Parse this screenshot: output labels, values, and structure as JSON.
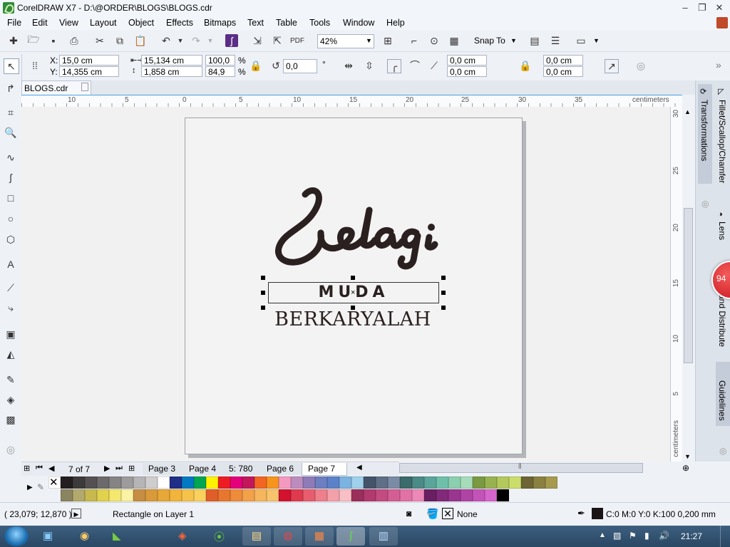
{
  "window": {
    "title": "CorelDRAW X7 - D:\\@ORDER\\BLOGS\\BLOGS.cdr",
    "min": "–",
    "max": "❐",
    "close": "✕"
  },
  "menu": [
    "File",
    "Edit",
    "View",
    "Layout",
    "Object",
    "Effects",
    "Bitmaps",
    "Text",
    "Table",
    "Tools",
    "Window",
    "Help"
  ],
  "toolbar": {
    "zoom": "42%",
    "snap_to": "Snap To"
  },
  "propbar": {
    "x": "15,0 cm",
    "y": "14,355 cm",
    "x_label": "X:",
    "y_label": "Y:",
    "width": "15,134 cm",
    "height": "1,858 cm",
    "scale_w": "100,0",
    "scale_h": "84,9",
    "percent": "%",
    "rotation": "0,0",
    "degree": "°",
    "corner1": "0,0 cm",
    "corner2": "0,0 cm",
    "corner3": "0,0 cm",
    "corner4": "0,0 cm"
  },
  "doc_tab": "BLOGS.cdr",
  "ruler": {
    "h_labels": [
      "10",
      "5",
      "0",
      "5",
      "10",
      "15",
      "20",
      "25",
      "30",
      "35"
    ],
    "unit": "centimeters",
    "v_labels": [
      "30",
      "25",
      "20",
      "15",
      "10",
      "5"
    ],
    "v_unit": "centimeters"
  },
  "artwork": {
    "script": "Selagi",
    "middle": "MUDA",
    "bottom": "BERKARYALAH"
  },
  "dockers": [
    "Transformations",
    "Fillet/Scallop/Chamfer",
    "Lens",
    "and Distribute",
    "Guidelines"
  ],
  "badge": "94",
  "pagenav": {
    "counter": "7 of 7",
    "tabs": [
      "Page 3",
      "Page 4",
      "5: 780",
      "Page 6",
      "Page 7"
    ],
    "active": "Page 7"
  },
  "palette": {
    "row1": [
      "#231f20",
      "#3d3a3b",
      "#555152",
      "#6d6a6b",
      "#858384",
      "#9d9b9c",
      "#b6b4b5",
      "#cfcdce",
      "#ffffff",
      "#1f2e86",
      "#0079c2",
      "#00a651",
      "#fff200",
      "#ed1c24",
      "#e3007a",
      "#c2185b",
      "#f26522",
      "#f7941d",
      "#f49ac1",
      "#bd8cbf",
      "#8f7bb8",
      "#6c7fc0",
      "#5b82c8",
      "#7bb3e2",
      "#9fd0ec",
      "#43546a",
      "#5f6f86",
      "#7a8ba5",
      "#3b6b6a",
      "#4b8a86",
      "#5aa59a",
      "#6fc0aa",
      "#8acfb0",
      "#a6dcba",
      "#7a9a42",
      "#98b24f",
      "#b4c95c",
      "#cbde6b",
      "#6d6535",
      "#8a8141",
      "#a59a4e"
    ],
    "row2": [
      "#8b8460",
      "#b3a96d",
      "#c8b94f",
      "#e1d14c",
      "#f4e86f",
      "#faf3a3",
      "#c68e43",
      "#d99a3a",
      "#e8a838",
      "#f2b43a",
      "#f7c24b",
      "#fbd15e",
      "#e05e2a",
      "#e8762e",
      "#ee8c3a",
      "#f3a24a",
      "#f5b65c",
      "#f7c46c",
      "#d3122f",
      "#e03a4f",
      "#e85d6d",
      "#ef7f8b",
      "#f4a0a9",
      "#f8c0c6",
      "#9c2e5b",
      "#b23a6e",
      "#c44b81",
      "#d45e93",
      "#e272a5",
      "#ee88b8",
      "#6a1f63",
      "#822a7a",
      "#9a3690",
      "#b044a5",
      "#c453b9",
      "#d665cc",
      "#000000"
    ]
  },
  "status": {
    "coords": "( 23,079; 12,870 )",
    "object": "Rectangle on Layer 1",
    "fill": "None",
    "outline": "C:0 M:0 Y:0 K:100  0,200 mm"
  },
  "taskbar": {
    "time": "21:27"
  },
  "colors": {
    "accent": "#4aa2e0",
    "artwork": "#2b2020"
  }
}
